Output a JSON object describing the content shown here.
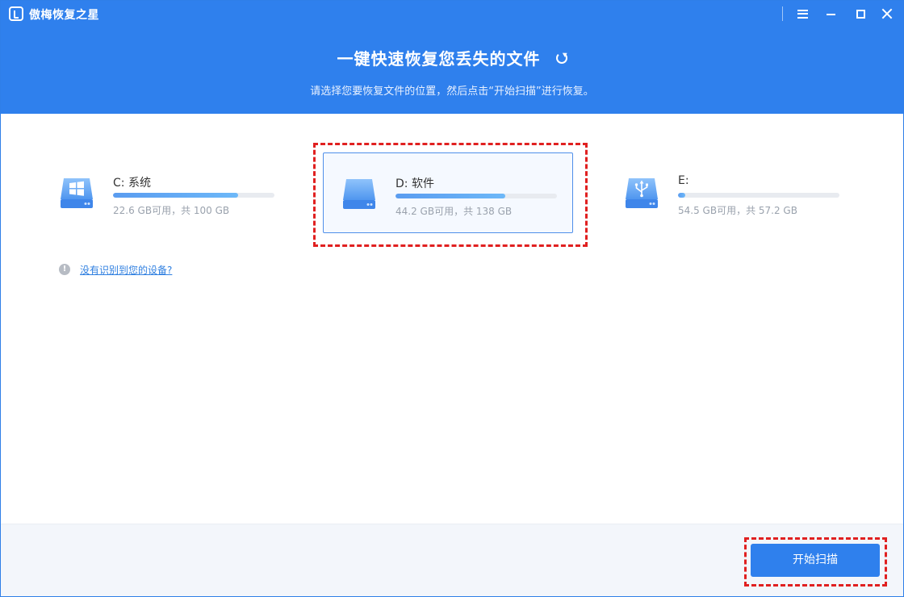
{
  "app": {
    "title": "傲梅恢复之星",
    "headline": "一键快速恢复您丢失的文件",
    "subtitle": "请选择您要恢复文件的位置，然后点击“开始扫描”进行恢复。"
  },
  "drives": [
    {
      "name": "C: 系统",
      "size_text": "22.6 GB可用，共 100 GB",
      "used_fraction": 0.774,
      "icon": "windows-drive-icon"
    },
    {
      "name": "D: 软件",
      "size_text": "44.2 GB可用，共 138 GB",
      "used_fraction": 0.68,
      "icon": "drive-icon",
      "selected": true
    },
    {
      "name": "E:",
      "size_text": "54.5 GB可用，共 57.2 GB",
      "used_fraction": 0.047,
      "icon": "usb-drive-icon"
    }
  ],
  "help": {
    "link_text": "没有识别到您的设备?"
  },
  "footer": {
    "scan_label": "开始扫描"
  },
  "colors": {
    "accent": "#2f80ed",
    "highlight_dash": "#e02020",
    "bar_fill": "#5a9cf0"
  }
}
